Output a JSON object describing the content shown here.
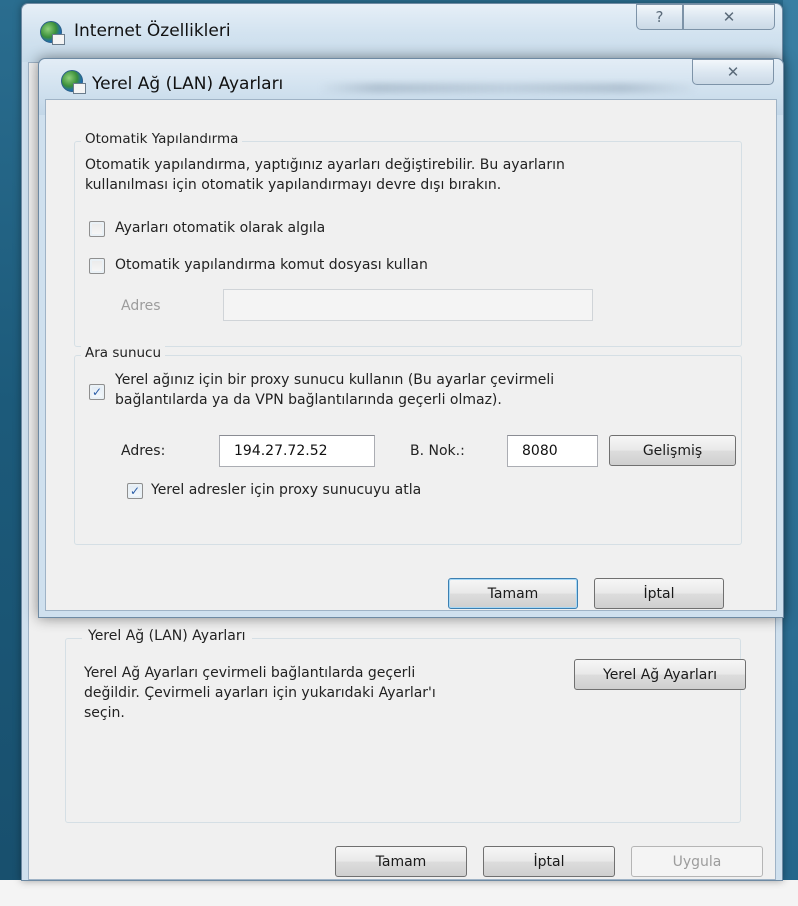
{
  "outer_window": {
    "title": "Internet Özellikleri",
    "help_glyph": "?",
    "close_glyph": "✕",
    "lan_group": {
      "legend": "Yerel Ağ (LAN) Ayarları",
      "description": [
        "Yerel Ağ Ayarları çevirmeli bağlantılarda geçerli",
        "değildir. Çevirmeli ayarları için yukarıdaki Ayarlar'ı",
        "seçin."
      ],
      "lan_settings_button": "Yerel Ağ Ayarları"
    },
    "buttons": {
      "ok": "Tamam",
      "cancel": "İptal",
      "apply": "Uygula"
    }
  },
  "dialog": {
    "title": "Yerel Ağ (LAN) Ayarları",
    "close_glyph": "✕",
    "auto_config": {
      "legend": "Otomatik Yapılandırma",
      "description": [
        "Otomatik yapılandırma, yaptığınız ayarları değiştirebilir. Bu ayarların",
        "kullanılması için otomatik yapılandırmayı devre dışı bırakın."
      ],
      "auto_detect": {
        "label": "Ayarları otomatik olarak algıla",
        "checked": false
      },
      "use_script": {
        "label": "Otomatik yapılandırma komut dosyası kullan",
        "checked": false
      },
      "address_label": "Adres",
      "address_value": ""
    },
    "proxy": {
      "legend": "Ara sunucu",
      "use_proxy": {
        "label_lines": [
          "Yerel ağınız için bir proxy sunucu kullanın (Bu ayarlar çevirmeli",
          "bağlantılarda ya da VPN bağlantılarında geçerli olmaz)."
        ],
        "checked": true
      },
      "address_label": "Adres:",
      "address_value": "194.27.72.52",
      "port_label": "B. Nok.:",
      "port_value": "8080",
      "advanced_button": "Gelişmiş",
      "bypass_local": {
        "label": "Yerel adresler için proxy sunucuyu atla",
        "checked": true
      }
    },
    "buttons": {
      "ok": "Tamam",
      "cancel": "İptal"
    }
  },
  "icons": {
    "app": "internet-options-globe-icon",
    "check": "checkmark-icon"
  },
  "colors": {
    "desktop": "#1c5a7a",
    "window_frame": "#cfe0ee",
    "dialog_face": "#f0f0f0",
    "check_mark": "#2b5ea8"
  }
}
